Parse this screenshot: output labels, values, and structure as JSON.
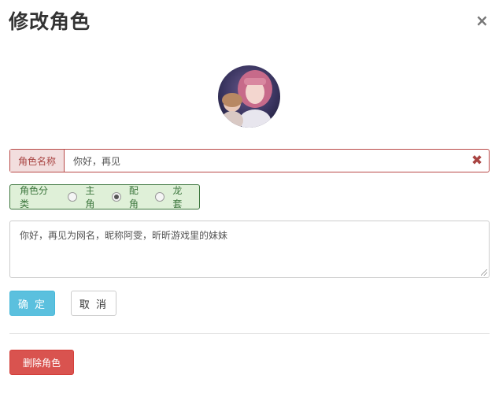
{
  "dialog": {
    "title": "修改角色"
  },
  "icons": {
    "close": "close-icon",
    "clear": "clear-icon",
    "avatar": "avatar-image"
  },
  "name_field": {
    "label": "角色名称",
    "value": "你好，再见"
  },
  "category": {
    "label": "角色分类",
    "options": [
      {
        "label": "主角",
        "checked": false
      },
      {
        "label": "配角",
        "checked": true
      },
      {
        "label": "龙套",
        "checked": false
      }
    ]
  },
  "description": {
    "value": "你好，再见为网名，昵称阿雯，昕昕游戏里的妹妹"
  },
  "buttons": {
    "confirm": "确 定",
    "cancel": "取 消",
    "delete": "删除角色"
  },
  "colors": {
    "error_border": "#b94a48",
    "error_bg": "#f2dede",
    "success_border": "#3c763d",
    "success_bg": "#dff0d8",
    "info": "#5bc0de",
    "danger": "#d9534f"
  }
}
